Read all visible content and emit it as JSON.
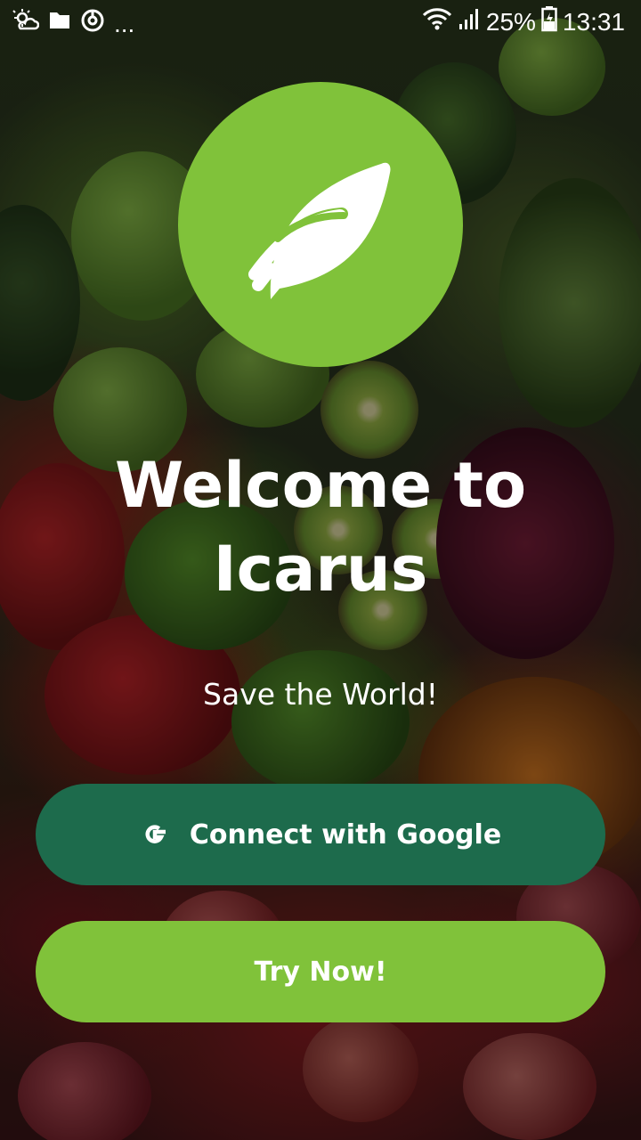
{
  "status_bar": {
    "left_icons": [
      "weather-icon",
      "folder-icon",
      "sync-icon"
    ],
    "overflow": "...",
    "battery": "25%",
    "time": "13:31"
  },
  "logo": {
    "icon": "leaf-icon",
    "color": "#80c23a"
  },
  "welcome": {
    "title_line1": "Welcome to",
    "title_line2": "Icarus",
    "subtitle": "Save the World!"
  },
  "actions": {
    "google_label": "Connect with Google",
    "google_color": "#1d6b4c",
    "try_label": "Try Now!",
    "try_color": "#80c23a"
  }
}
